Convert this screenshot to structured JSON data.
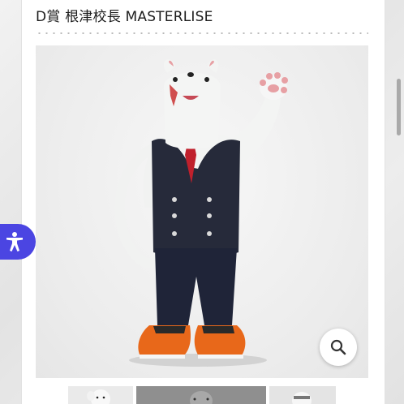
{
  "product": {
    "title": "D賞 根津校長 MASTERLISE"
  },
  "gallery": {
    "main_image_subject": "white-mouse-principal-figure",
    "zoom_icon": "magnifier-icon",
    "thumbnails": [
      {
        "name": "thumbnail-1"
      },
      {
        "name": "thumbnail-2"
      },
      {
        "name": "thumbnail-3"
      }
    ]
  },
  "accessibility": {
    "icon": "accessibility-person-icon",
    "color": "#4b45e2"
  },
  "colors": {
    "vest": "#262a3a",
    "tie": "#c0202c",
    "shoes": "#e8681a",
    "fur": "#f4f5f4"
  }
}
